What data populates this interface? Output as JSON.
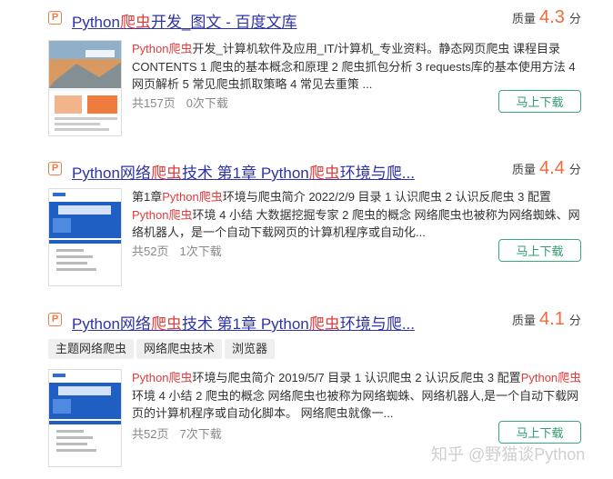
{
  "results": [
    {
      "title_parts": [
        "Python",
        "爬虫",
        "开发_图文 - 百度文库"
      ],
      "quality_label": "质量",
      "score": "4.3",
      "score_unit": "分",
      "desc_parts": [
        "Python",
        "爬虫",
        "开发_计算机软件及应用_IT/计算机_专业资料。静态网页爬虫 课程目录 CONTENTS 1 爬虫的基本概念和原理 2 爬虫抓包分析 3 requests库的基本使用方法 4 网页解析 5 常见爬虫抓取策略 4 常见去重策 ..."
      ],
      "pages": "共157页",
      "downloads": "0次下载",
      "download_button": "马上下载"
    },
    {
      "title_parts": [
        "Python网络",
        "爬虫",
        "技术 第1章 Python",
        "爬虫",
        "环境与爬..."
      ],
      "quality_label": "质量",
      "score": "4.4",
      "score_unit": "分",
      "desc_parts": [
        "第1章",
        "Python爬虫",
        "环境与爬虫简介 2022/2/9 目录 1 认识爬虫 2 认识反爬虫 3 配置",
        "Python爬虫",
        "环境 4 小结 大数据挖掘专家 2 爬虫的概念 网络爬虫也被称为网络蜘蛛、网络机器人，是一个自动下载网页的计算机程序或自动化..."
      ],
      "pages": "共52页",
      "downloads": "1次下载",
      "download_button": "马上下载"
    },
    {
      "title_parts": [
        "Python网络",
        "爬虫",
        "技术 第1章 Python",
        "爬虫",
        "环境与爬..."
      ],
      "quality_label": "质量",
      "score": "4.1",
      "score_unit": "分",
      "tags": [
        "主题网络爬虫",
        "网络爬虫技术",
        "浏览器"
      ],
      "desc_parts": [
        "Python爬虫",
        "环境与爬虫简介 2019/5/7 目录 1 认识爬虫 2 认识反爬虫 3 配置",
        "Python爬虫",
        "环境 4 小结 2 爬虫的概念 网络爬虫也被称为网络蜘蛛、网络机器人,是一个自动下载网页的计算机程序或自动化脚本。 网络爬虫就像一..."
      ],
      "pages": "共52页",
      "downloads": "7次下载",
      "download_button": "马上下载"
    }
  ],
  "file_icon_letter": "P",
  "watermark": "知乎 @野猫谈Python",
  "colors": {
    "title": "#2e33a5",
    "highlight": "#e03c3c",
    "score": "#f36a3a",
    "button": "#3aa87c"
  }
}
